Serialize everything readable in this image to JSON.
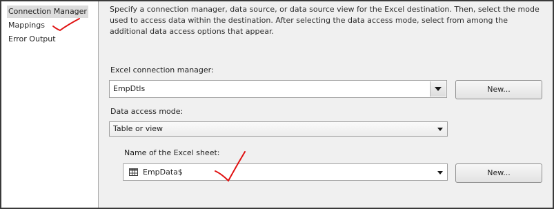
{
  "nav": {
    "items": [
      {
        "label": "Connection Manager"
      },
      {
        "label": "Mappings"
      },
      {
        "label": "Error Output"
      }
    ]
  },
  "description": "Specify a connection manager, data source, or data source view for the Excel destination. Then, select the mode used to access data within the destination. After selecting the data access mode, select from among the additional data access options that appear.",
  "connection": {
    "label": "Excel connection manager:",
    "value": "EmpDtls",
    "new_label": "New..."
  },
  "access_mode": {
    "label": "Data access mode:",
    "value": "Table or view"
  },
  "sheet": {
    "label": "Name of the Excel sheet:",
    "value": "EmpData$",
    "new_label": "New...",
    "icon": "table-icon"
  },
  "annotations": {
    "checkmark_color": "#e01010"
  }
}
